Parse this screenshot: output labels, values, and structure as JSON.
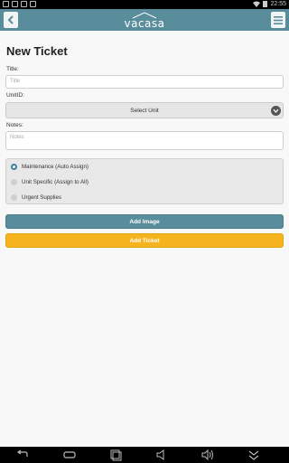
{
  "statusbar": {
    "time": "22:55"
  },
  "appbar": {
    "brand": "vacasa"
  },
  "page": {
    "title": "New Ticket"
  },
  "form": {
    "title_label": "Title:",
    "title_placeholder": "Title",
    "unit_label": "UnitID:",
    "unit_selected": "Select Unit",
    "notes_label": "Notes:",
    "notes_placeholder": "Notes"
  },
  "radio_options": [
    {
      "label": "Maintenance (Auto Assign)",
      "selected": true
    },
    {
      "label": "Unit Specific (Assign to All)",
      "selected": false
    },
    {
      "label": "Urgent Supplies",
      "selected": false
    }
  ],
  "buttons": {
    "add_image": "Add Image",
    "add_ticket": "Add Ticket"
  },
  "colors": {
    "appbar": "#5a8d9b",
    "accent": "#f5b41e",
    "radio_on": "#3b7fa3"
  }
}
